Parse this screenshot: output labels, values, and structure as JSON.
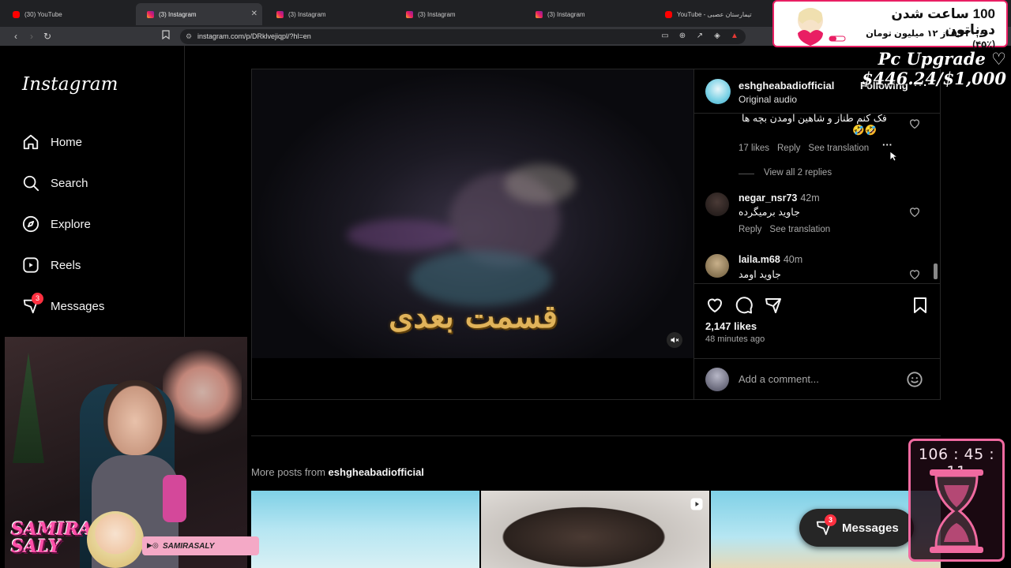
{
  "browser": {
    "tabs": [
      {
        "label": "(30) YouTube",
        "favicon": "youtube-icon",
        "active": false
      },
      {
        "label": "(3) Instagram",
        "favicon": "instagram-icon",
        "active": true
      },
      {
        "label": "(3) Instagram",
        "favicon": "instagram-icon",
        "active": false
      },
      {
        "label": "(3) Instagram",
        "favicon": "instagram-icon",
        "active": false
      },
      {
        "label": "(3) Instagram",
        "favicon": "instagram-icon",
        "active": false
      },
      {
        "label": "YouTube - تیمارستان عصبی",
        "favicon": "youtube-icon",
        "active": false
      }
    ],
    "url": "instagram.com/p/DRklvejiqpl/?hl=en"
  },
  "sidebar": {
    "logo": "Instagram",
    "items": [
      {
        "label": "Home",
        "icon": "home-icon"
      },
      {
        "label": "Search",
        "icon": "search-icon"
      },
      {
        "label": "Explore",
        "icon": "compass-icon"
      },
      {
        "label": "Reels",
        "icon": "reels-icon"
      },
      {
        "label": "Messages",
        "icon": "messenger-icon",
        "badge": "3"
      }
    ]
  },
  "post": {
    "video_caption": "قسمت بعدی",
    "author": "eshgheabadiofficial",
    "audio": "Original audio",
    "follow_state": "Following",
    "comments": [
      {
        "text": "فک کنم طناز و شاهین اومدن بچه ها",
        "emoji": "🤣🤣",
        "likes": "17 likes",
        "reply": "Reply",
        "translate": "See translation",
        "view_replies": "View all 2 replies"
      },
      {
        "user": "negar_nsr73",
        "time": "42m",
        "text": "جاوید برمیگرده",
        "reply": "Reply",
        "translate": "See translation"
      },
      {
        "user": "laila.m68",
        "time": "40m",
        "text": "جاوید اومد"
      }
    ],
    "likes": "2,147 likes",
    "time_ago": "48 minutes ago",
    "comment_placeholder": "Add a comment..."
  },
  "more_posts": {
    "prefix": "More posts from",
    "user": "eshgheabadiofficial"
  },
  "floating_messages": {
    "label": "Messages",
    "badge": "3"
  },
  "overlay": {
    "donation_title": "100 ساعت شدن دوناتون",
    "donation_sub": "۵,۴۲۰,۰۰۰ از ۱۲ میلیون تومان (٪۴۵)",
    "donation_progress": 0.45,
    "pc_goal": "Pc Upgrade ♡ $446.24/$1,000",
    "streamer_name_line1": "SAMIRA",
    "streamer_name_line2": "SALY",
    "streamer_handle": "SAMIRASALY",
    "timer": "106 : 45 : 11"
  },
  "colors": {
    "background": "#000000",
    "border": "#262626",
    "badge": "#ff3040",
    "overlay_pink": "#f06aa0",
    "caption_gold": "#e0b35a"
  }
}
